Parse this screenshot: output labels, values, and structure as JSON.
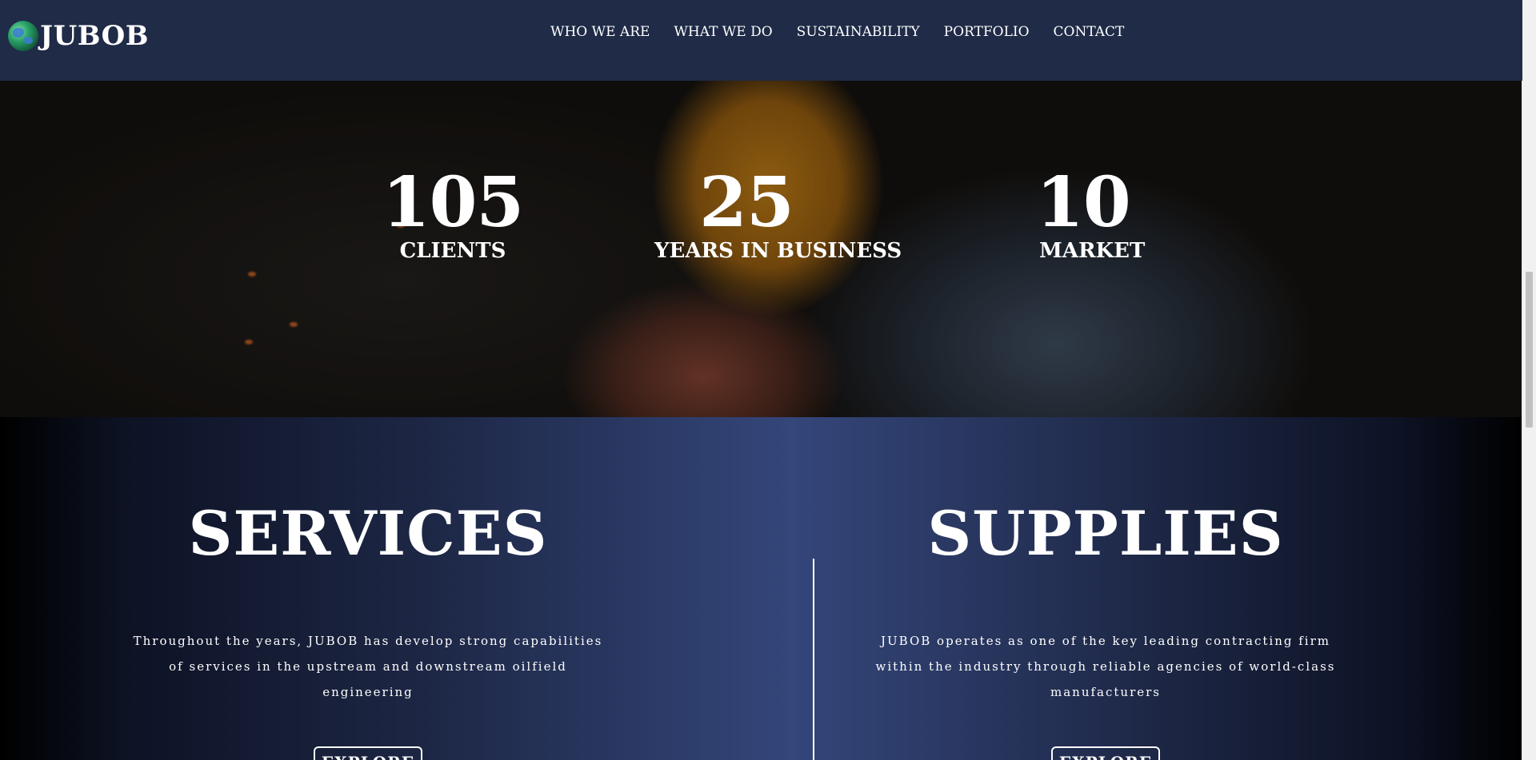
{
  "header": {
    "logo_text": "JUBOB",
    "nav": [
      "WHO WE ARE",
      "WHAT WE DO",
      "SUSTAINABILITY",
      "PORTFOLIO",
      "CONTACT"
    ]
  },
  "stats": [
    {
      "number": "105",
      "label": "CLIENTS"
    },
    {
      "number": "25",
      "label": "YEARS IN BUSINESS"
    },
    {
      "number": "10",
      "label": "MARKET"
    }
  ],
  "services": {
    "title": "SERVICES",
    "text": "Throughout the years, JUBOB has develop strong capabilities of services in the upstream and downstream oilfield engineering",
    "button": "EXPLORE"
  },
  "supplies": {
    "title": "SUPPLIES",
    "text": "JUBOB operates as one of the key leading contracting firm within the industry through reliable agencies of world-class manufacturers",
    "button": "EXPLORE"
  },
  "colors": {
    "header_bg": "#1f2b47",
    "section_center": "#34467a",
    "text": "#ffffff"
  }
}
